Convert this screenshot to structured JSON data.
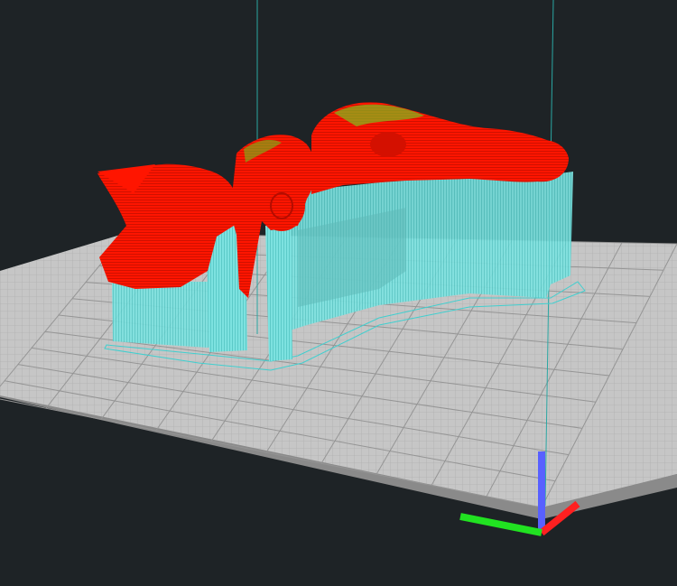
{
  "viewport": {
    "background": "#1e2326",
    "view": "3d-perspective-slice-preview"
  },
  "build_plate": {
    "surface_color": "#c6c6c6",
    "grid_color": "#9a9a9a",
    "edge_color": "#8c8c8c",
    "grid_minor_lines": 60
  },
  "model": {
    "layer_color": "#ff1500",
    "top_skin_color": "#6fbf1a",
    "support_color": "#7de2e0",
    "outline_color": "#40cfcf"
  },
  "axis_gizmo": {
    "x_color": "#ff2020",
    "y_color": "#21e221",
    "z_color": "#5860ff"
  },
  "guide_lines": {
    "color": "#2aa7a3"
  }
}
